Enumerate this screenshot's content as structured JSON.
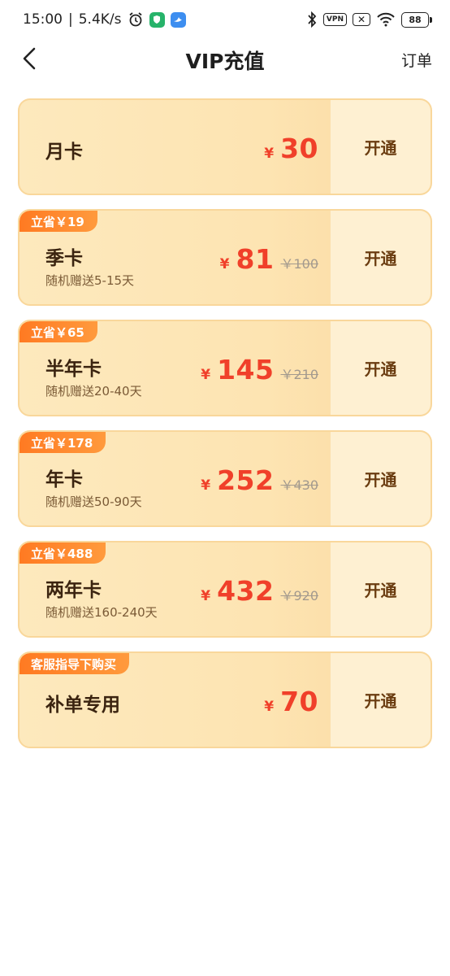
{
  "status_bar": {
    "time": "15:00",
    "separator": "|",
    "net_speed": "5.4K/s",
    "vpn_label": "VPN",
    "battery": "88"
  },
  "nav": {
    "title": "VIP充值",
    "orders_label": "订单"
  },
  "colors": {
    "accent_red": "#f0402a",
    "badge_orange": "#ff7a22",
    "card_bg": "#fde9bd",
    "button_text": "#6a3c10"
  },
  "plans": [
    {
      "badge": "",
      "name": "月卡",
      "subtitle": "",
      "yen": "¥",
      "price": "30",
      "original": "",
      "button": "开通"
    },
    {
      "badge": "立省￥19",
      "name": "季卡",
      "subtitle": "随机赠送5-15天",
      "yen": "¥",
      "price": "81",
      "original": "￥100",
      "button": "开通"
    },
    {
      "badge": "立省￥65",
      "name": "半年卡",
      "subtitle": "随机赠送20-40天",
      "yen": "¥",
      "price": "145",
      "original": "￥210",
      "button": "开通"
    },
    {
      "badge": "立省￥178",
      "name": "年卡",
      "subtitle": "随机赠送50-90天",
      "yen": "¥",
      "price": "252",
      "original": "￥430",
      "button": "开通"
    },
    {
      "badge": "立省￥488",
      "name": "两年卡",
      "subtitle": "随机赠送160-240天",
      "yen": "¥",
      "price": "432",
      "original": "￥920",
      "button": "开通"
    },
    {
      "badge": "客服指导下购买",
      "name": "补单专用",
      "subtitle": "",
      "yen": "¥",
      "price": "70",
      "original": "",
      "button": "开通"
    }
  ]
}
